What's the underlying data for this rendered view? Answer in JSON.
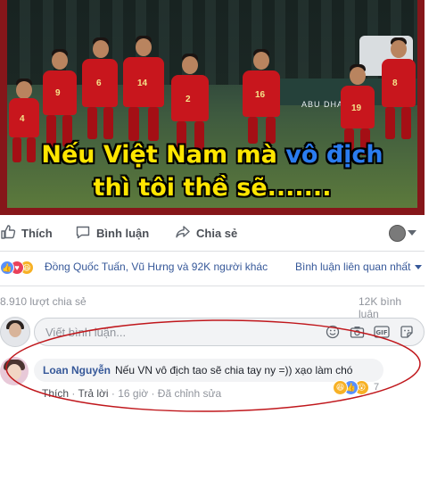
{
  "photo": {
    "caption_line1_a": "Nếu Việt Nam mà ",
    "caption_line1_b": "vô địch",
    "caption_line2": "thì tôi thề sẽ.......",
    "ad_text": "ABU DHABI",
    "jersey_numbers": [
      "4",
      "9",
      "6",
      "14",
      "2",
      "16",
      "19",
      "8"
    ],
    "colors": {
      "frame": "#86161a",
      "jersey": "#c8161d",
      "caption_yellow": "#ffe600",
      "caption_blue": "#2a7cf0"
    }
  },
  "actions": {
    "like": "Thích",
    "comment": "Bình luận",
    "share": "Chia sẻ"
  },
  "reactions": {
    "names": "Đồng Quốc Tuấn, Vũ Hưng và 92K người khác",
    "filter": "Bình luận liên quan nhất"
  },
  "counts": {
    "shares": "8.910 lượt chia sẻ",
    "comments": "12K bình luận"
  },
  "composer": {
    "placeholder": "Viết bình luận..."
  },
  "comment": {
    "author": "Loan Nguyễn",
    "text": "Nếu VN vô địch tao sẽ chia tay ny =)) xạo làm chó",
    "like": "Thích",
    "reply": "Trả lời",
    "time": "16 giờ",
    "edited": "Đã chỉnh sửa",
    "separator": " · ",
    "reaction_count": "7"
  },
  "annotation": {
    "color": "#c0171c"
  },
  "brand": {
    "link": "#365899",
    "muted": "#90949c",
    "text": "#4b4f56"
  }
}
